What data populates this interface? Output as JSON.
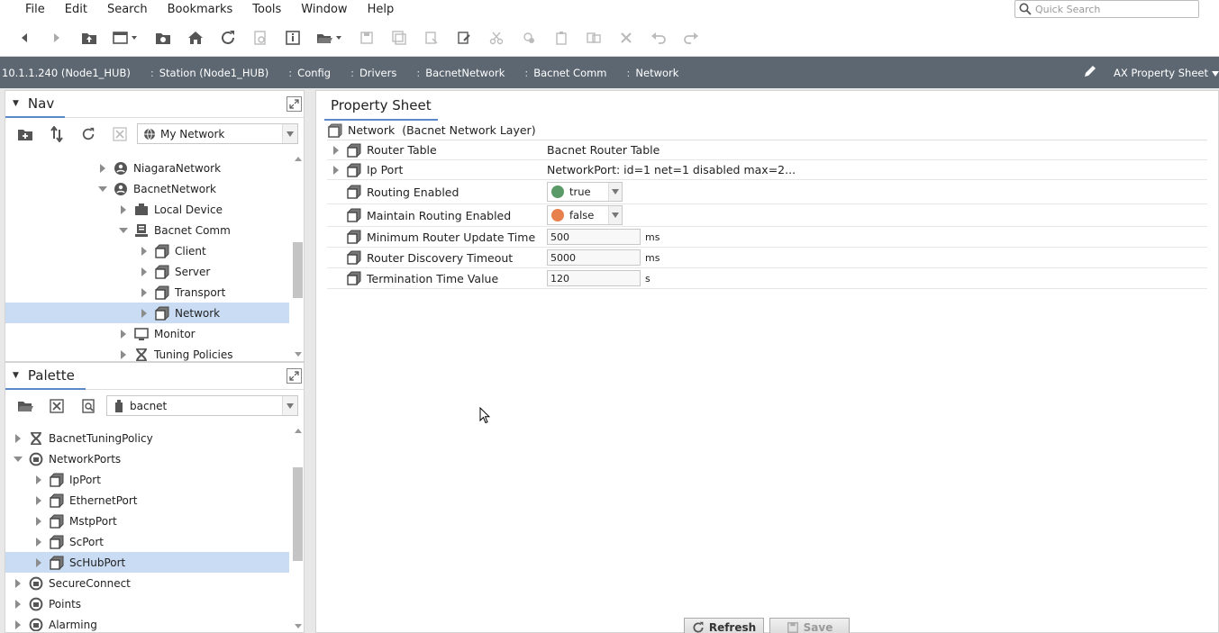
{
  "menubar": {
    "items": [
      "File",
      "Edit",
      "Search",
      "Bookmarks",
      "Tools",
      "Window",
      "Help"
    ],
    "search_placeholder": "Quick Search"
  },
  "breadcrumb": {
    "items": [
      "10.1.1.240 (Node1_HUB)",
      "Station (Node1_HUB)",
      "Config",
      "Drivers",
      "BacnetNetwork",
      "Bacnet Comm",
      "Network"
    ],
    "view": "AX Property Sheet"
  },
  "nav": {
    "title": "Nav",
    "combo": "My Network",
    "tree": [
      {
        "label": "NiagaraNetwork",
        "indent": 0,
        "state": "collapsed",
        "icon": "network-icon"
      },
      {
        "label": "BacnetNetwork",
        "indent": 0,
        "state": "expanded",
        "icon": "network-icon"
      },
      {
        "label": "Local Device",
        "indent": 1,
        "state": "collapsed",
        "icon": "device-icon"
      },
      {
        "label": "Bacnet Comm",
        "indent": 1,
        "state": "expanded",
        "icon": "comm-icon"
      },
      {
        "label": "Client",
        "indent": 2,
        "state": "collapsed",
        "icon": "component-icon"
      },
      {
        "label": "Server",
        "indent": 2,
        "state": "collapsed",
        "icon": "component-icon"
      },
      {
        "label": "Transport",
        "indent": 2,
        "state": "collapsed",
        "icon": "component-icon"
      },
      {
        "label": "Network",
        "indent": 2,
        "state": "collapsed",
        "icon": "component-icon",
        "selected": true
      },
      {
        "label": "Monitor",
        "indent": 1,
        "state": "collapsed",
        "icon": "monitor-icon"
      },
      {
        "label": "Tuning Policies",
        "indent": 1,
        "state": "collapsed",
        "icon": "tuning-icon"
      }
    ]
  },
  "palette": {
    "title": "Palette",
    "combo": "bacnet",
    "tree": [
      {
        "label": "BacnetTuningPolicy",
        "indent": 0,
        "state": "collapsed",
        "icon": "tuning-icon"
      },
      {
        "label": "NetworkPorts",
        "indent": 0,
        "state": "expanded",
        "icon": "folder-round-icon"
      },
      {
        "label": "IpPort",
        "indent": 1,
        "state": "collapsed",
        "icon": "component-icon"
      },
      {
        "label": "EthernetPort",
        "indent": 1,
        "state": "collapsed",
        "icon": "component-icon"
      },
      {
        "label": "MstpPort",
        "indent": 1,
        "state": "collapsed",
        "icon": "component-icon"
      },
      {
        "label": "ScPort",
        "indent": 1,
        "state": "collapsed",
        "icon": "component-icon"
      },
      {
        "label": "ScHubPort",
        "indent": 1,
        "state": "collapsed",
        "icon": "component-icon",
        "selected": true
      },
      {
        "label": "SecureConnect",
        "indent": 0,
        "state": "collapsed",
        "icon": "folder-round-icon"
      },
      {
        "label": "Points",
        "indent": 0,
        "state": "collapsed",
        "icon": "folder-round-icon"
      },
      {
        "label": "Alarming",
        "indent": 0,
        "state": "collapsed",
        "icon": "folder-round-icon"
      }
    ]
  },
  "property_sheet": {
    "tab": "Property Sheet",
    "header_name": "Network",
    "header_type": "(Bacnet Network Layer)",
    "rows": [
      {
        "name": "Router Table",
        "kind": "text",
        "value": "Bacnet Router Table",
        "expandable": true
      },
      {
        "name": "Ip Port",
        "kind": "text",
        "value": "NetworkPort: id=1 net=1 disabled max=2...",
        "expandable": true
      },
      {
        "name": "Routing Enabled",
        "kind": "bool",
        "value": "true",
        "color": "#5a9a68"
      },
      {
        "name": "Maintain Routing Enabled",
        "kind": "bool",
        "value": "false",
        "color": "#e8804e"
      },
      {
        "name": "Minimum Router Update Time",
        "kind": "number",
        "value": "500",
        "unit": "ms"
      },
      {
        "name": "Router Discovery Timeout",
        "kind": "number",
        "value": "5000",
        "unit": "ms"
      },
      {
        "name": "Termination Time Value",
        "kind": "number",
        "value": "120",
        "unit": "s"
      }
    ],
    "refresh_label": "Refresh",
    "save_label": "Save"
  },
  "colors": {
    "breadcrumb_bg": "#5d6772",
    "selection": "#c9dcf3",
    "tab_accent": "#5d88c8"
  }
}
